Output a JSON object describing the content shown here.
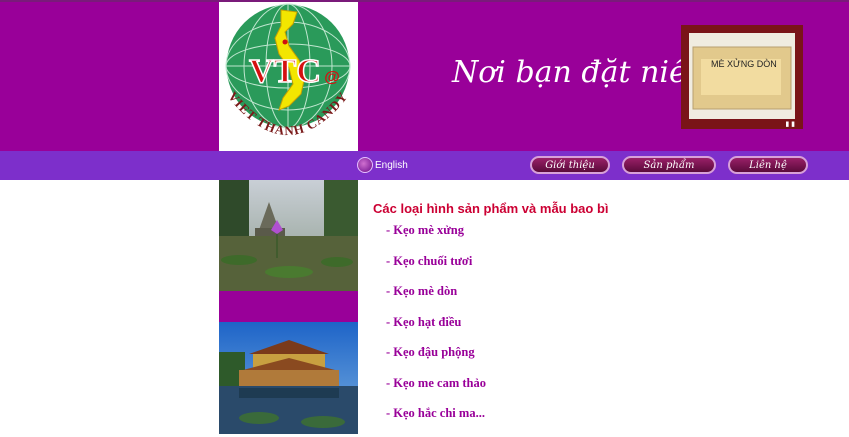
{
  "header": {
    "logo_text": "VTC",
    "logo_at": "@",
    "logo_arc": "VIET THANH CANDY",
    "slogan": "Nơi bạn đặt niềm tin...",
    "product_label": "MÈ XỬNG DÒN"
  },
  "navbar": {
    "language": "English",
    "buttons": [
      "Giới thiệu",
      "Sản phẩm",
      "Liên hệ"
    ]
  },
  "main": {
    "title": "Các loại hình sản phẩm và mẫu bao bì",
    "products": [
      "- Kẹo mè xửng",
      "- Kẹo chuối tươi",
      "- Kẹo mè dòn",
      "- Kẹo hạt điều",
      "- Kẹo đậu phộng",
      "- Kẹo me cam thảo",
      "- Kẹo hắc chi ma..."
    ]
  },
  "colors": {
    "header_bg": "#990099",
    "navbar_bg": "#7d2fcb",
    "title": "#cc0033",
    "link": "#990099"
  }
}
